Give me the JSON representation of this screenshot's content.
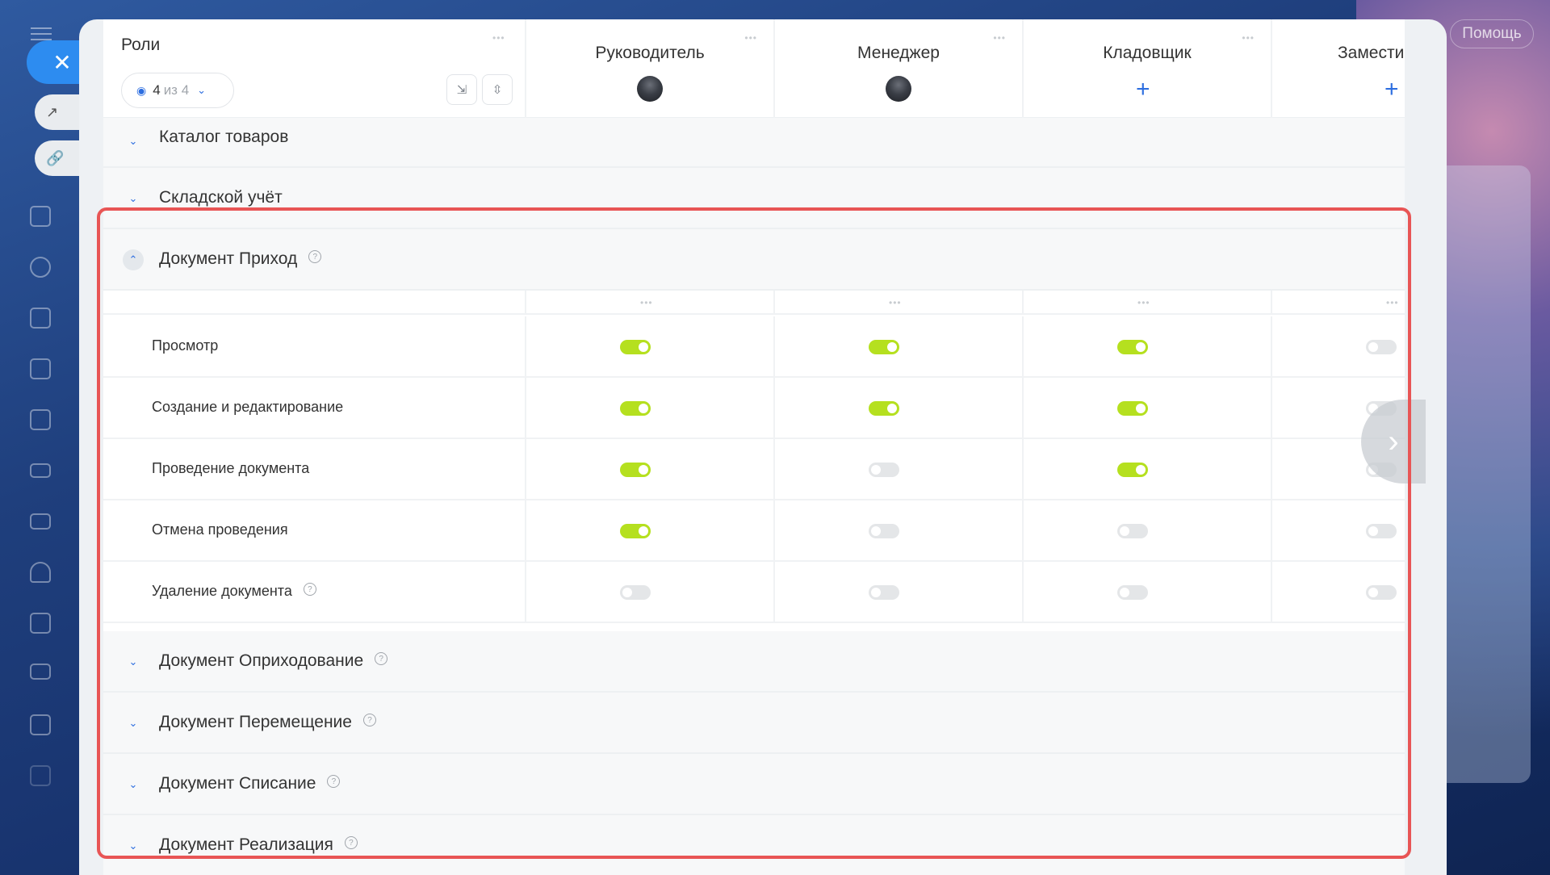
{
  "help_label": "Помощь",
  "roles_title": "Роли",
  "filter": {
    "count": "4",
    "of_label": "из 4"
  },
  "roles": [
    {
      "name": "Руководитель",
      "has_avatar": true
    },
    {
      "name": "Менеджер",
      "has_avatar": true
    },
    {
      "name": "Кладовщик",
      "has_avatar": false
    },
    {
      "name": "Замести",
      "has_avatar": false
    }
  ],
  "sections_above": [
    {
      "label": "Каталог товаров"
    },
    {
      "label": "Складской учёт"
    }
  ],
  "expanded_section": {
    "label": "Документ Приход",
    "permissions": [
      {
        "label": "Просмотр",
        "values": [
          true,
          true,
          true,
          false
        ]
      },
      {
        "label": "Создание и редактирование",
        "values": [
          true,
          true,
          true,
          false
        ]
      },
      {
        "label": "Проведение документа",
        "values": [
          true,
          false,
          true,
          false
        ]
      },
      {
        "label": "Отмена проведения",
        "values": [
          true,
          false,
          false,
          false
        ]
      },
      {
        "label": "Удаление документа",
        "values": [
          false,
          false,
          false,
          false
        ],
        "has_help": true
      }
    ]
  },
  "sections_below": [
    {
      "label": "Документ Оприходование"
    },
    {
      "label": "Документ Перемещение"
    },
    {
      "label": "Документ Списание"
    },
    {
      "label": "Документ Реализация"
    }
  ],
  "colors": {
    "toggle_on": "#b5e01f",
    "toggle_off": "#e4e6e8",
    "accent": "#2d6ee0",
    "highlight": "#e85555"
  }
}
